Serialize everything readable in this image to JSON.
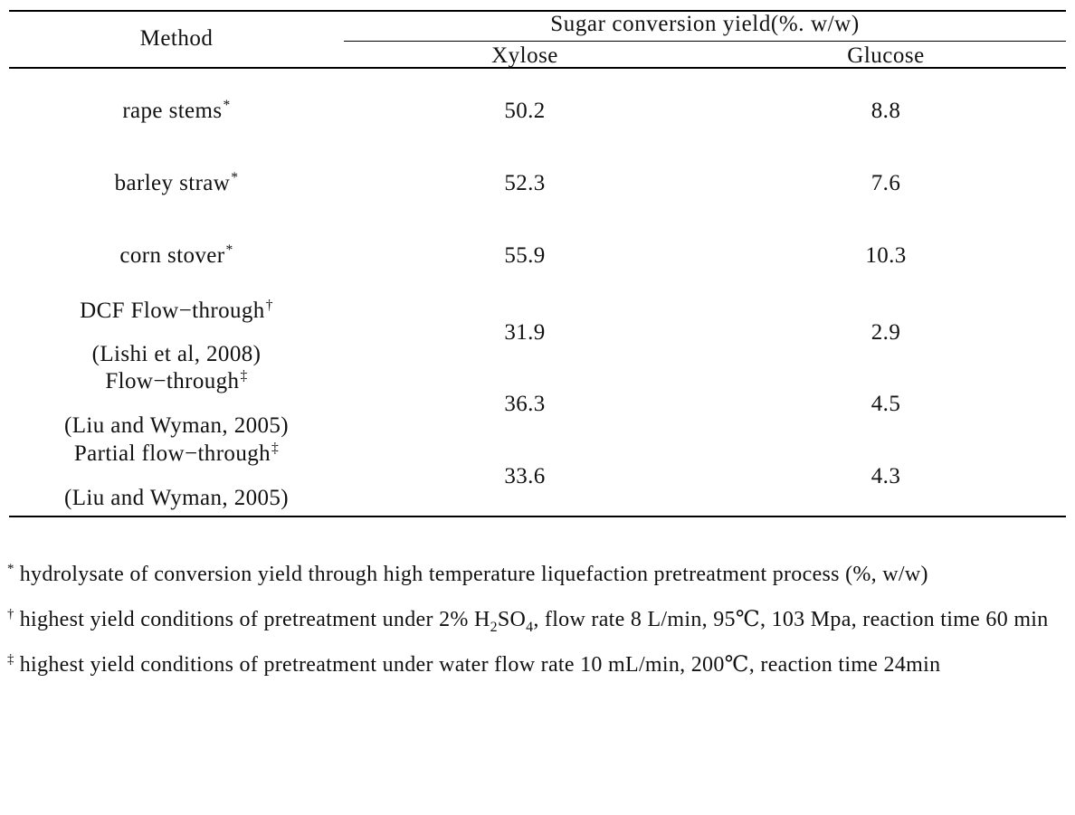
{
  "table": {
    "header": {
      "method_label": "Method",
      "group_label": "Sugar conversion yield(%. w/w)",
      "sub_columns": [
        "Xylose",
        "Glucose"
      ]
    },
    "rows": [
      {
        "method": "rape stems",
        "method_marker": "*",
        "method_second_line": "",
        "xylose": "50.2",
        "glucose": "8.8"
      },
      {
        "method": "barley straw",
        "method_marker": "*",
        "method_second_line": "",
        "xylose": "52.3",
        "glucose": "7.6"
      },
      {
        "method": "corn stover",
        "method_marker": "*",
        "method_second_line": "",
        "xylose": "55.9",
        "glucose": "10.3"
      },
      {
        "method": "DCF Flow−through",
        "method_marker": "†",
        "method_second_line": "(Lishi et al, 2008)",
        "xylose": "31.9",
        "glucose": "2.9"
      },
      {
        "method": "Flow−through",
        "method_marker": "‡",
        "method_second_line": "(Liu and Wyman, 2005)",
        "xylose": "36.3",
        "glucose": "4.5"
      },
      {
        "method": "Partial flow−through",
        "method_marker": "‡",
        "method_second_line": "(Liu and Wyman, 2005)",
        "xylose": "33.6",
        "glucose": "4.3"
      }
    ]
  },
  "footnotes": [
    {
      "marker": "*",
      "text": "hydrolysate of conversion yield through high temperature liquefaction pretreatment process (%, w/w)"
    },
    {
      "marker": "†",
      "text_before_formula": "highest yield conditions of pretreatment under 2% H",
      "formula_sub1": "2",
      "formula_mid": "SO",
      "formula_sub2": "4",
      "text_after_formula": ", flow rate 8 L/min, 95℃, 103 Mpa, reaction time 60 min"
    },
    {
      "marker": "‡",
      "text": "highest yield conditions of pretreatment under water flow rate 10 mL/min, 200℃, reaction time 24min"
    }
  ]
}
